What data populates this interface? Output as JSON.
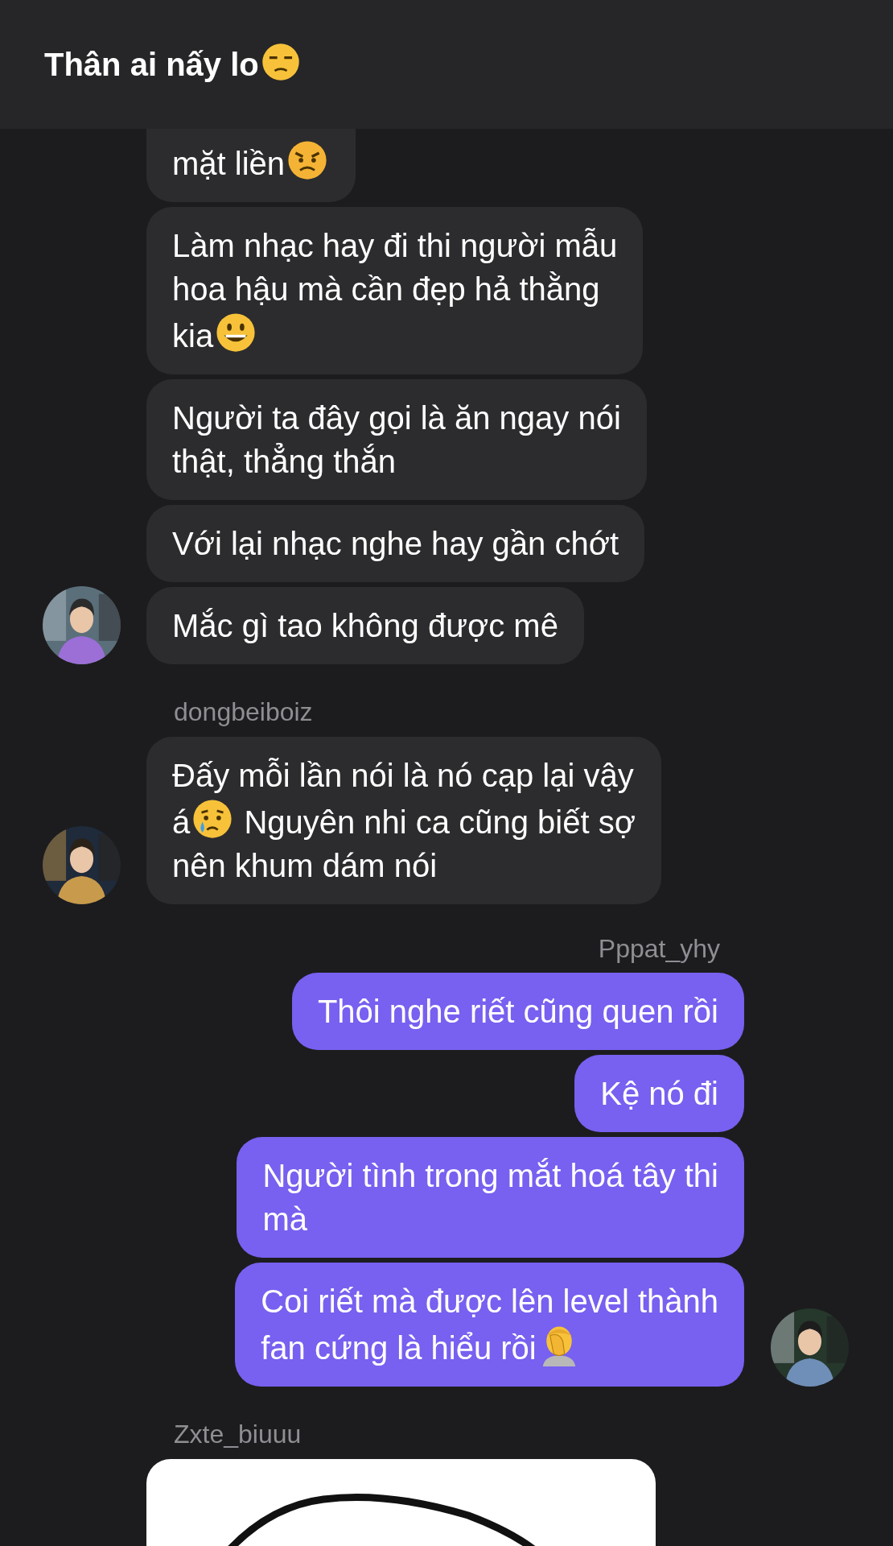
{
  "header": {
    "title_parts": [
      {
        "kind": "text",
        "text": "Thân ai nấy lo"
      },
      {
        "kind": "unamused"
      }
    ]
  },
  "groups": [
    {
      "kind": "received",
      "avatar": true,
      "messages": [
        {
          "kind": "text",
          "cut_top": true,
          "parts": [
            {
              "kind": "text",
              "text": "mặt liền"
            },
            {
              "kind": "angry"
            }
          ]
        },
        {
          "kind": "text",
          "parts": [
            {
              "kind": "text",
              "text": "Làm nhạc hay đi thi người mẫu hoa hậu mà cần đẹp hả thằng kia"
            },
            {
              "kind": "grinning"
            }
          ]
        },
        {
          "kind": "text",
          "parts": [
            {
              "kind": "text",
              "text": "Người ta đây gọi là ăn ngay nói thật, thẳng thắn"
            }
          ]
        },
        {
          "kind": "text",
          "parts": [
            {
              "kind": "text",
              "text": "Với lại nhạc nghe hay gần chớt"
            }
          ]
        },
        {
          "kind": "text",
          "parts": [
            {
              "kind": "text",
              "text": "Mắc gì tao không được mê"
            }
          ]
        }
      ]
    },
    {
      "kind": "received",
      "sender": "dongbeiboiz",
      "avatar": true,
      "messages": [
        {
          "kind": "text",
          "parts": [
            {
              "kind": "text",
              "text": "Đấy mỗi lần nói là nó cạp lại vậy á"
            },
            {
              "kind": "crying"
            },
            {
              "kind": "text",
              "text": " Nguyên nhi ca cũng biết sợ nên khum dám nói"
            }
          ]
        }
      ]
    },
    {
      "kind": "sent",
      "sender": "Pppat_yhy",
      "avatar": true,
      "messages": [
        {
          "kind": "text",
          "parts": [
            {
              "kind": "text",
              "text": "Thôi nghe riết cũng quen rồi"
            }
          ]
        },
        {
          "kind": "text",
          "parts": [
            {
              "kind": "text",
              "text": "Kệ nó đi"
            }
          ]
        },
        {
          "kind": "text",
          "parts": [
            {
              "kind": "text",
              "text": "Người tình trong mắt hoá tây thi mà"
            }
          ]
        },
        {
          "kind": "text",
          "parts": [
            {
              "kind": "text",
              "text": "Coi riết mà được lên level thành fan cứng là hiểu rồi"
            },
            {
              "kind": "facepalm"
            }
          ]
        }
      ]
    },
    {
      "kind": "received",
      "sender": "Zxte_biuuu",
      "avatar": false
    }
  ]
}
